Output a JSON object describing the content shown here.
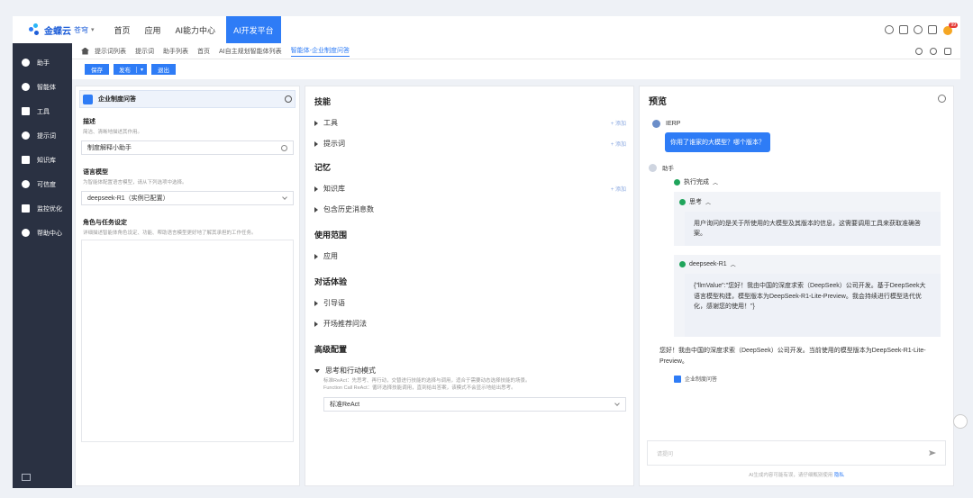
{
  "header": {
    "logo_text": "金蝶云",
    "logo_sub": "苍穹",
    "nav": [
      {
        "label": "首页"
      },
      {
        "label": "应用"
      },
      {
        "label": "AI能力中心"
      },
      {
        "label": "AI开发平台"
      }
    ],
    "badge": "99"
  },
  "sidebar": {
    "items": [
      {
        "label": "助手",
        "icon": "robot-icon"
      },
      {
        "label": "智能体",
        "icon": "agent-icon"
      },
      {
        "label": "工具",
        "icon": "tool-icon"
      },
      {
        "label": "提示词",
        "icon": "prompt-icon"
      },
      {
        "label": "知识库",
        "icon": "database-icon"
      },
      {
        "label": "可信度",
        "icon": "shield-icon"
      },
      {
        "label": "监控优化",
        "icon": "monitor-icon"
      },
      {
        "label": "帮助中心",
        "icon": "help-icon"
      }
    ]
  },
  "breadcrumb": [
    "提示词列表",
    "提示词",
    "助手列表",
    "首页",
    "AI自主规划智能体列表",
    "智能体-企业制度问答"
  ],
  "toolbar": {
    "save": "保存",
    "publish": "发布",
    "exit": "退出"
  },
  "left": {
    "agent_name": "企业制度问答",
    "desc_title": "描述",
    "desc_hint": "简洁、清晰地描述其作用。",
    "desc_value": "制度解释小助手",
    "model_title": "语言模型",
    "model_hint": "为智能体配置语言模型，请从下列选项中选择。",
    "model_value": "deepseek-R1（实例已配置）",
    "role_title": "角色与任务设定",
    "role_hint": "详细描述智能体角色设定、功能、帮助语言模型更好地了解其承担的工作任务。"
  },
  "mid": {
    "skills_title": "技能",
    "tools": "工具",
    "prompts": "提示词",
    "add": "+ 添加",
    "memory_title": "记忆",
    "kb": "知识库",
    "history": "包含历史消息数",
    "scope_title": "使用范围",
    "app": "应用",
    "dialog_title": "对话体验",
    "guide": "引导语",
    "opening": "开场推荐问法",
    "adv_title": "高级配置",
    "mode": "思考和行动模式",
    "mode_desc1": "标准ReAct：先思考、再行动，交替进行技能的选择与调用，适合于需要动态选择技能的场景。",
    "mode_desc2": "Function Call ReAct：循环选择技能调用，直到给出答案，该模式不会显示地给出思考。",
    "mode_value": "标准ReAct"
  },
  "right": {
    "title": "预览",
    "user_name": "IERP",
    "user_msg": "你用了谁家的大模型？哪个版本？",
    "assistant_name": "助手",
    "status_done": "执行完成",
    "think_label": "思考",
    "think_text": "用户询问的是关于所使用的大模型及其版本的信息，这需要调用工具来获取准确答案。",
    "model_label": "deepseek-R1",
    "model_text": "{\"llmValue\":\"您好！我由中国的深度求索（DeepSeek）公司开发。基于DeepSeek大语言模型构建，模型版本为DeepSeek-R1-Lite-Preview。我会持续进行模型迭代优化，感谢您的使用！\"}",
    "answer": "您好！我由中国的深度求索（DeepSeek）公司开发。当前使用的模型版本为DeepSeek-R1-Lite-Preview。",
    "source": "企业制度问答",
    "input_placeholder": "请提问",
    "footer_text": "AI生成内容可能有误，请仔细甄别使用",
    "footer_link": "隐私"
  }
}
